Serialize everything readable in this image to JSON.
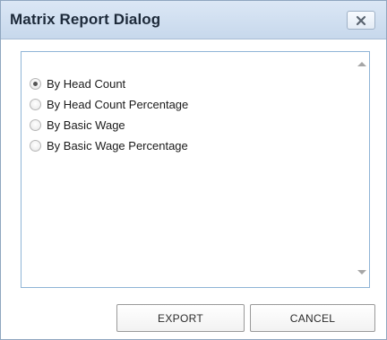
{
  "dialog": {
    "title": "Matrix Report Dialog",
    "close_icon": "close-icon"
  },
  "options": [
    {
      "label": "By Head Count",
      "checked": true
    },
    {
      "label": "By Head Count Percentage",
      "checked": false
    },
    {
      "label": "By Basic Wage",
      "checked": false
    },
    {
      "label": "By Basic Wage Percentage",
      "checked": false
    }
  ],
  "scrollbar": {
    "up_icon": "scroll-up-arrow-icon",
    "down_icon": "scroll-down-arrow-icon"
  },
  "buttons": {
    "export_label": "EXPORT",
    "cancel_label": "CANCEL"
  }
}
